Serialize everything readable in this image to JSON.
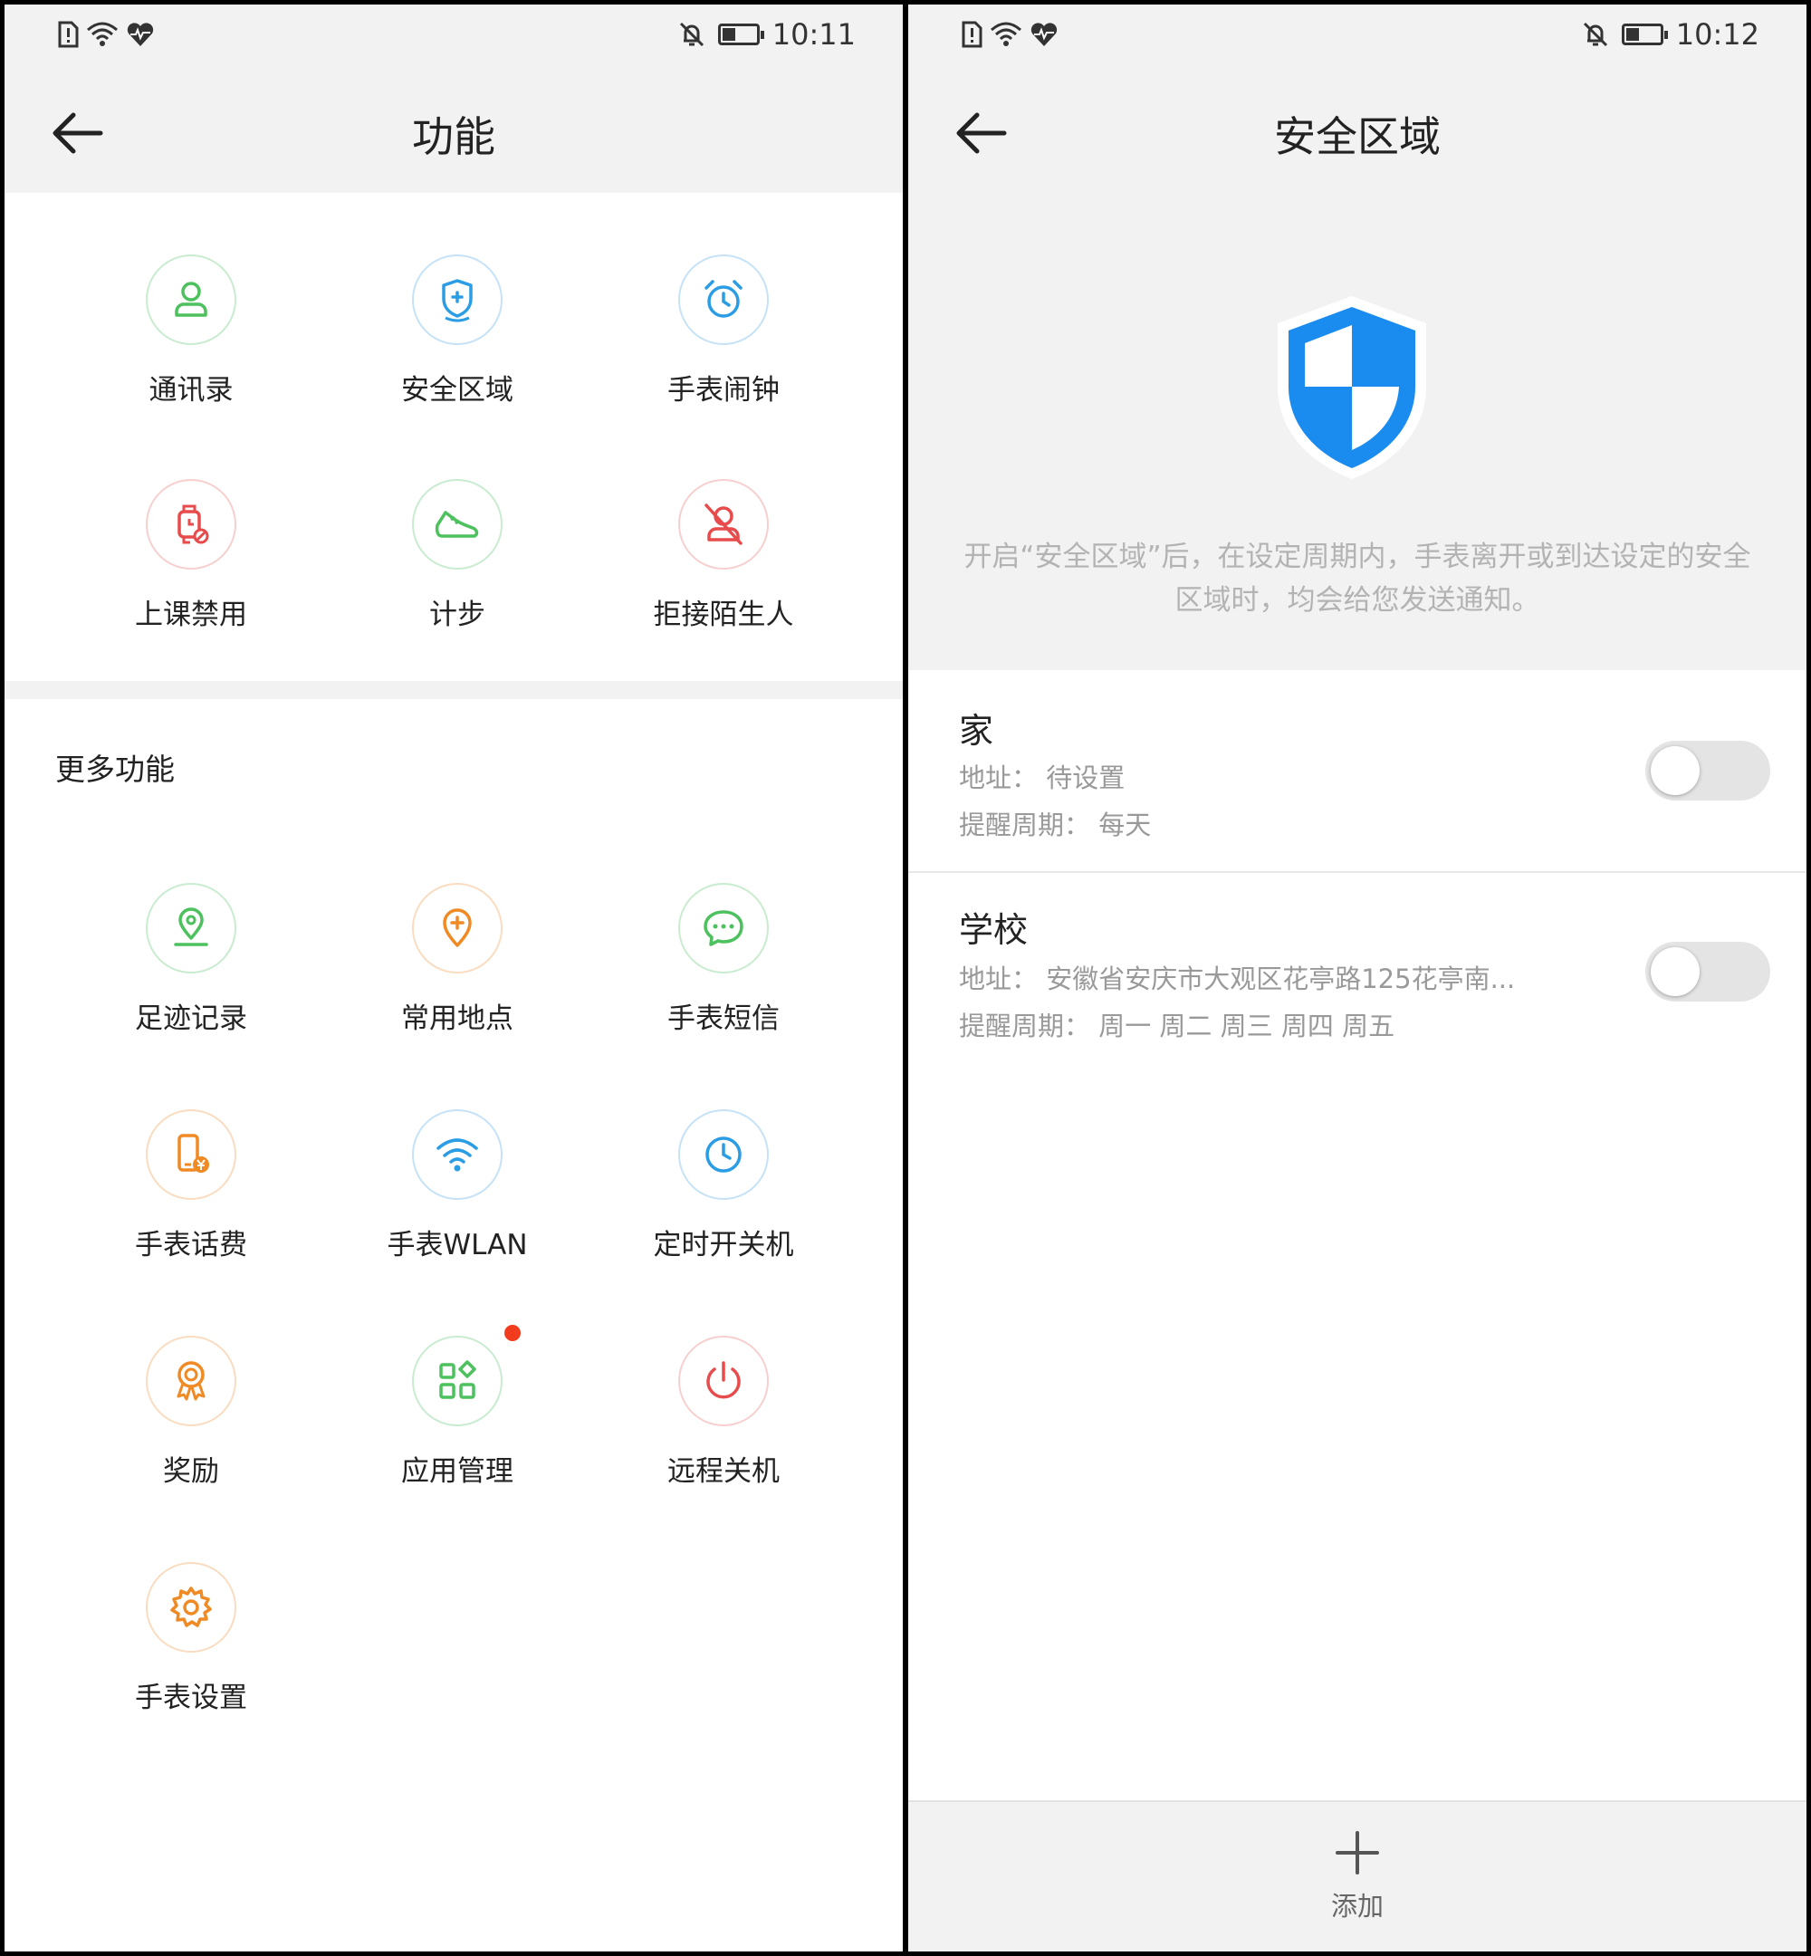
{
  "left": {
    "status": {
      "time": "10:11"
    },
    "title": "功能",
    "main_items": [
      {
        "label": "通讯录",
        "icon": "contact-person-icon",
        "color": "#4cc15d"
      },
      {
        "label": "安全区域",
        "icon": "shield-location-icon",
        "color": "#2b9de4"
      },
      {
        "label": "手表闹钟",
        "icon": "alarm-clock-icon",
        "color": "#2b9de4"
      },
      {
        "label": "上课禁用",
        "icon": "watch-ban-icon",
        "color": "#e84b4b"
      },
      {
        "label": "计步",
        "icon": "sneaker-icon",
        "color": "#4cc15d"
      },
      {
        "label": "拒接陌生人",
        "icon": "stranger-block-icon",
        "color": "#e84b4b"
      }
    ],
    "more_title": "更多功能",
    "more_items": [
      {
        "label": "足迹记录",
        "icon": "footprint-location-icon",
        "color": "#4cc15d"
      },
      {
        "label": "常用地点",
        "icon": "location-plus-icon",
        "color": "#f08a24"
      },
      {
        "label": "手表短信",
        "icon": "chat-bubble-icon",
        "color": "#4cc15d"
      },
      {
        "label": "手表话费",
        "icon": "phone-fee-icon",
        "color": "#f08a24"
      },
      {
        "label": "手表WLAN",
        "icon": "wifi-icon",
        "color": "#2b9de4"
      },
      {
        "label": "定时开关机",
        "icon": "clock-icon",
        "color": "#2b9de4"
      },
      {
        "label": "奖励",
        "icon": "award-medal-icon",
        "color": "#f08a24"
      },
      {
        "label": "应用管理",
        "icon": "app-grid-icon",
        "color": "#4cc15d"
      },
      {
        "label": "远程关机",
        "icon": "power-icon",
        "color": "#e84b4b"
      },
      {
        "label": "手表设置",
        "icon": "gear-icon",
        "color": "#f08a24"
      }
    ]
  },
  "right": {
    "status": {
      "time": "10:12"
    },
    "title": "安全区域",
    "description": "开启“安全区域”后，在设定周期内，手表离开或到达设定的安全区域时，均会给您发送通知。",
    "zones": [
      {
        "name": "家",
        "address": "地址：  待设置",
        "period": "提醒周期：  每天",
        "enabled": false
      },
      {
        "name": "学校",
        "address": "地址：  安徽省安庆市大观区花亭路125花亭南...",
        "period": "提醒周期：  周一  周二  周三  周四  周五",
        "enabled": false
      }
    ],
    "add_label": "添加"
  },
  "colors": {
    "shield_blue": "#1a8cf0",
    "badge_red": "#f13d1d",
    "panel_gray": "#f2f2f2"
  }
}
